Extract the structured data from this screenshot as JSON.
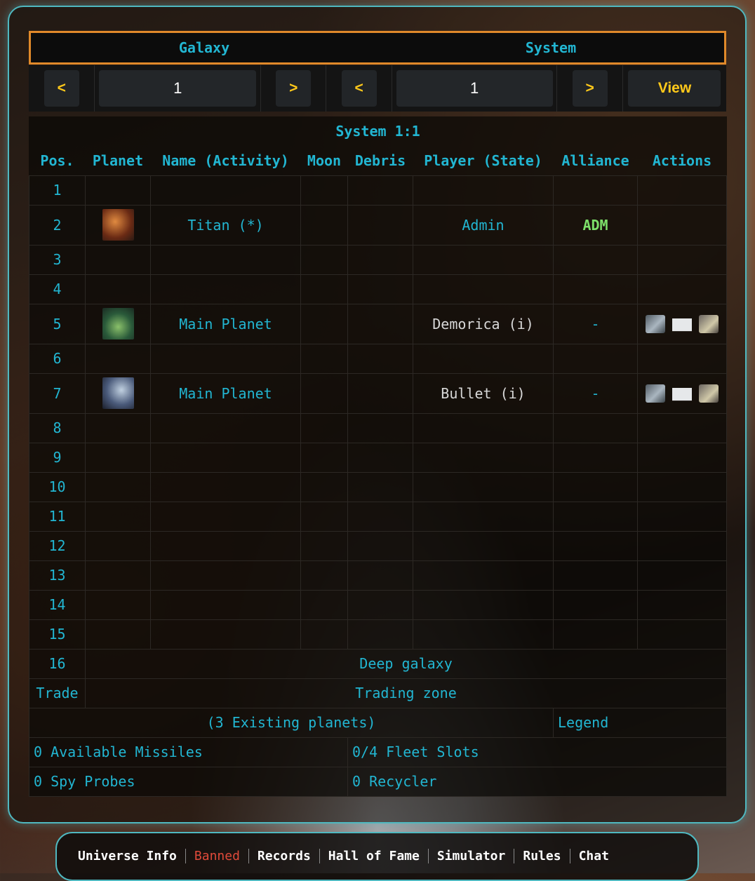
{
  "header": {
    "galaxy_label": "Galaxy",
    "system_label": "System"
  },
  "nav": {
    "galaxy_prev": "<",
    "galaxy_value": "1",
    "galaxy_next": ">",
    "system_prev": "<",
    "system_value": "1",
    "system_next": ">",
    "view_label": "View"
  },
  "table": {
    "title": "System 1:1",
    "columns": [
      "Pos.",
      "Planet",
      "Name (Activity)",
      "Moon",
      "Debris",
      "Player (State)",
      "Alliance",
      "Actions"
    ],
    "rows": [
      {
        "pos": "1"
      },
      {
        "pos": "2",
        "planet_img": "planet-image",
        "name": "Titan (*)",
        "player": "Admin",
        "alliance": "ADM"
      },
      {
        "pos": "3"
      },
      {
        "pos": "4"
      },
      {
        "pos": "5",
        "planet_img": "planet-image",
        "name": "Main Planet",
        "player": "Demorica (i)",
        "alliance": "-",
        "actions": [
          "espionage-icon",
          "message-icon",
          "buddy-icon"
        ]
      },
      {
        "pos": "6"
      },
      {
        "pos": "7",
        "planet_img": "planet-image",
        "name": "Main Planet",
        "player": "Bullet (i)",
        "alliance": "-",
        "actions": [
          "espionage-icon",
          "message-icon",
          "buddy-icon"
        ]
      },
      {
        "pos": "8"
      },
      {
        "pos": "9"
      },
      {
        "pos": "10"
      },
      {
        "pos": "11"
      },
      {
        "pos": "12"
      },
      {
        "pos": "13"
      },
      {
        "pos": "14"
      },
      {
        "pos": "15"
      }
    ],
    "deep": {
      "pos": "16",
      "label": "Deep galaxy"
    },
    "trade": {
      "pos": "Trade",
      "label": "Trading zone"
    },
    "existing": "(3 Existing planets)",
    "legend": "Legend",
    "missiles": "0 Available Missiles",
    "fleet_slots": "0/4 Fleet Slots",
    "spy_probes": "0 Spy Probes",
    "recycler": "0 Recycler"
  },
  "footer": {
    "links": [
      "Universe Info",
      "Banned",
      "Records",
      "Hall of Fame",
      "Simulator",
      "Rules",
      "Chat"
    ]
  },
  "colors": {
    "accent": "#22b6d2",
    "frame": "#e0892a",
    "alliance": "#7de06a",
    "button_text": "#ffc91a",
    "banned": "#e04a3a"
  }
}
